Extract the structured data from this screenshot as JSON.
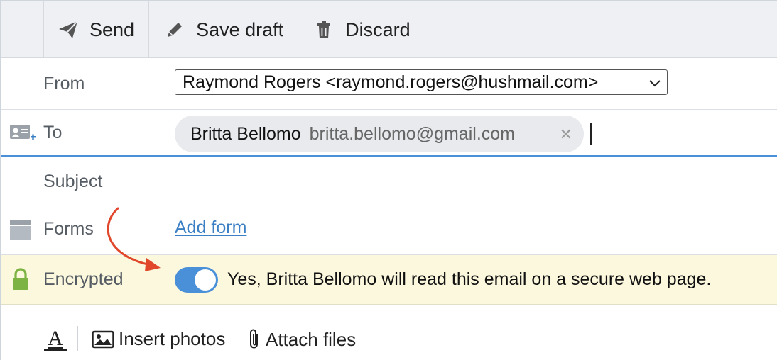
{
  "toolbar": {
    "send_label": "Send",
    "save_draft_label": "Save draft",
    "discard_label": "Discard"
  },
  "from": {
    "label": "From",
    "value": "Raymond Rogers <raymond.rogers@hushmail.com>"
  },
  "to": {
    "label": "To",
    "recipients": [
      {
        "name": "Britta Bellomo",
        "email": "britta.bellomo@gmail.com"
      }
    ]
  },
  "subject": {
    "label": "Subject",
    "value": ""
  },
  "forms": {
    "label": "Forms",
    "add_form_link": "Add form"
  },
  "encrypted": {
    "label": "Encrypted",
    "toggle_on": true,
    "message": "Yes, Britta Bellomo will read this email on a secure web page."
  },
  "format_bar": {
    "insert_photos_label": "Insert photos",
    "attach_files_label": "Attach files"
  },
  "colors": {
    "accent_blue": "#4a90d9",
    "link_blue": "#3b7fc4",
    "lock_green": "#7cb342",
    "annotation_arrow": "#e0472b",
    "encrypted_bg": "#fcf8de"
  },
  "icons": {
    "send": "paper-plane-icon",
    "save_draft": "pencil-icon",
    "discard": "trash-icon",
    "contacts": "contact-card-add-icon",
    "forms": "form-icon",
    "encrypted": "lock-icon",
    "text_format": "text-format-icon",
    "photos": "image-icon",
    "attach": "paperclip-icon"
  }
}
